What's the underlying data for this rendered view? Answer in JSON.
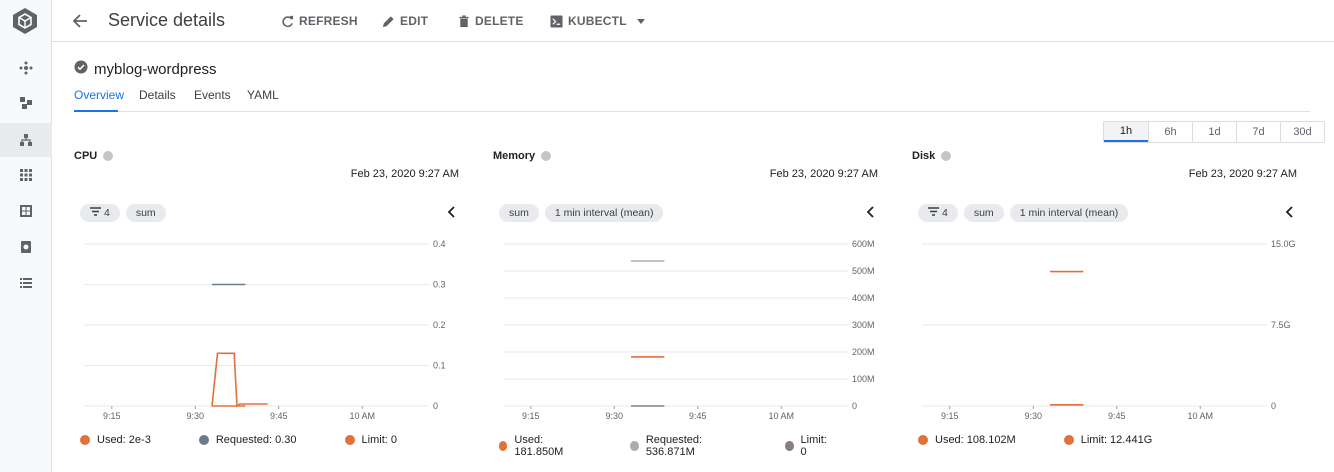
{
  "header": {
    "title": "Service details",
    "refresh_label": "REFRESH",
    "edit_label": "EDIT",
    "delete_label": "DELETE",
    "kubectl_label": "KUBECTL"
  },
  "service": {
    "name": "myblog-wordpress",
    "status_icon": "check-circle-icon"
  },
  "tabs": [
    "Overview",
    "Details",
    "Events",
    "YAML"
  ],
  "time_range": {
    "options": [
      "1h",
      "6h",
      "1d",
      "7d",
      "30d"
    ],
    "selected": "1h"
  },
  "rail": {
    "items": [
      "cluster-icon",
      "workloads-icon",
      "services-icon",
      "applications-icon",
      "configuration-icon",
      "storage-icon",
      "object-browser-icon"
    ],
    "active_index": 2
  },
  "colors": {
    "used": "#e2703a",
    "requested_cpu": "#6b7b8c",
    "requested_memory": "#a9aeb3",
    "limit_memory": "#8b7b86",
    "limit": "#e2703a",
    "accent": "#1a73e8"
  },
  "panels": [
    {
      "title": "CPU",
      "timestamp": "Feb 23, 2020 9:27 AM",
      "chips": [
        "4",
        "sum"
      ],
      "legend": [
        {
          "label": "Used: 2e-3",
          "color": "#e2703a"
        },
        {
          "label": "Requested: 0.30",
          "color": "#6b7b8c"
        },
        {
          "label": "Limit: 0",
          "color": "#e2703a"
        }
      ]
    },
    {
      "title": "Memory",
      "timestamp": "Feb 23, 2020 9:27 AM",
      "chips": [
        "sum",
        "1 min interval (mean)"
      ],
      "legend": [
        {
          "label": "Used: 181.850M",
          "color": "#e2703a"
        },
        {
          "label": "Requested: 536.871M",
          "color": "#a9aeb3"
        },
        {
          "label": "Limit: 0",
          "color": "#8b7b86"
        }
      ]
    },
    {
      "title": "Disk",
      "timestamp": "Feb 23, 2020 9:27 AM",
      "chips": [
        "4",
        "sum",
        "1 min interval (mean)"
      ],
      "legend": [
        {
          "label": "Used: 108.102M",
          "color": "#e2703a"
        },
        {
          "label": "Limit: 12.441G",
          "color": "#e2703a"
        }
      ]
    }
  ],
  "chart_data": [
    {
      "type": "line",
      "title": "CPU",
      "x_ticks": [
        "9:15",
        "9:30",
        "9:45",
        "10 AM"
      ],
      "y_ticks": [
        "0.4",
        "0.3",
        "0.2",
        "0.1",
        "0"
      ],
      "ylim": [
        0,
        0.4
      ],
      "series": [
        {
          "name": "Used",
          "x": [
            "9:33",
            "9:34",
            "9:34.5",
            "9:37",
            "9:37.5",
            "9:38",
            "9:43"
          ],
          "values": [
            0,
            0.13,
            0.13,
            0.13,
            0,
            0.005,
            0.005
          ]
        },
        {
          "name": "Requested",
          "x": [
            "9:33",
            "9:39"
          ],
          "values": [
            0.3,
            0.3
          ]
        },
        {
          "name": "Limit",
          "x": [
            "9:33",
            "9:39"
          ],
          "values": [
            0,
            0
          ]
        }
      ]
    },
    {
      "type": "line",
      "title": "Memory",
      "x_ticks": [
        "9:15",
        "9:30",
        "9:45",
        "10 AM"
      ],
      "y_ticks": [
        "600M",
        "500M",
        "400M",
        "300M",
        "200M",
        "100M",
        "0"
      ],
      "ylim": [
        0,
        600
      ],
      "series": [
        {
          "name": "Used",
          "x": [
            "9:33",
            "9:39"
          ],
          "values": [
            181.85,
            181.85
          ]
        },
        {
          "name": "Requested",
          "x": [
            "9:33",
            "9:39"
          ],
          "values": [
            536.871,
            536.871
          ]
        },
        {
          "name": "Limit",
          "x": [
            "9:33",
            "9:39"
          ],
          "values": [
            0,
            0
          ]
        }
      ]
    },
    {
      "type": "line",
      "title": "Disk",
      "x_ticks": [
        "9:15",
        "9:30",
        "9:45",
        "10 AM"
      ],
      "y_ticks": [
        "15.0G",
        "7.5G",
        "0"
      ],
      "ylim": [
        0,
        15
      ],
      "series": [
        {
          "name": "Used",
          "x": [
            "9:33",
            "9:39"
          ],
          "values": [
            0.108,
            0.108
          ]
        },
        {
          "name": "Limit",
          "x": [
            "9:33",
            "9:39"
          ],
          "values": [
            12.441,
            12.441
          ]
        }
      ]
    }
  ]
}
